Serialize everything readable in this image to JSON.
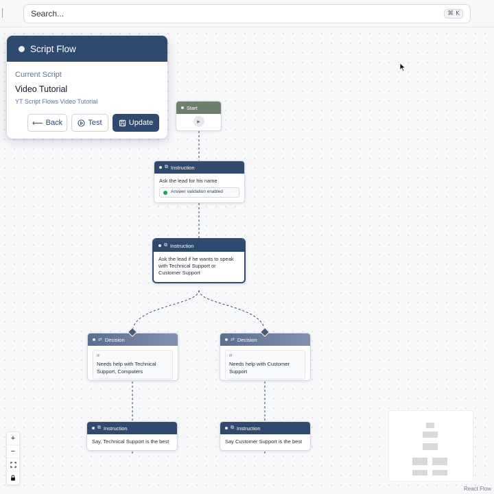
{
  "search": {
    "placeholder": "Search...",
    "shortcut": "⌘ K"
  },
  "script_card": {
    "header": "Script Flow",
    "current_label": "Current Script",
    "name": "Video Tutorial",
    "description": "YT Script Flows Video Tutorial",
    "buttons": {
      "back": "Back",
      "test": "Test",
      "update": "Update"
    }
  },
  "nodes": {
    "start": {
      "label": "Start"
    },
    "instr1": {
      "type": "Instruction",
      "text": "Ask the lead for his name",
      "badge": "Answer validation enabled"
    },
    "instr2": {
      "type": "Instruction",
      "text": "Ask the lead if he wants to speak with Technical Support or Customer Support"
    },
    "dec_left": {
      "type": "Decision",
      "if": "IF",
      "condition": "Needs help with Technical Support, Computers"
    },
    "dec_right": {
      "type": "Decision",
      "if": "IF",
      "condition": "Needs help with Customer Support"
    },
    "instr_left": {
      "type": "Instruction",
      "text": "Say, Technical Support is the best"
    },
    "instr_right": {
      "type": "Instruction",
      "text": "Say Customer Support is the best"
    }
  },
  "controls": {
    "zoom_in": "+",
    "zoom_out": "−"
  },
  "attribution": "React Flow",
  "colors": {
    "primary": "#2f4a6e",
    "start_header": "#6b7f6c",
    "validation_dot": "#22a35a"
  }
}
